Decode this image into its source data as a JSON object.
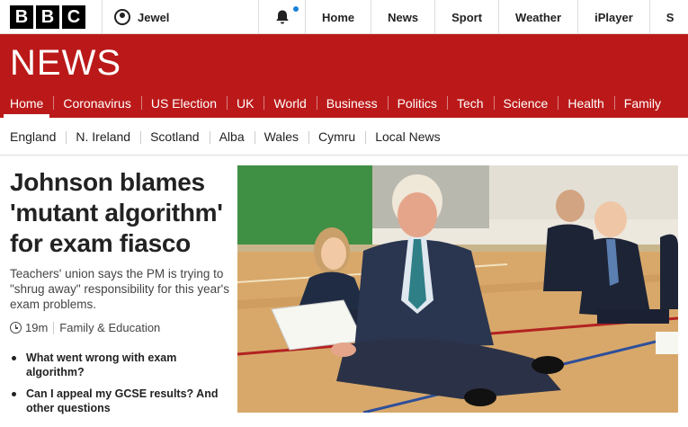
{
  "masthead": {
    "logo_letters": [
      "B",
      "B",
      "C"
    ],
    "account_label": "Jewel",
    "nav": [
      "Home",
      "News",
      "Sport",
      "Weather",
      "iPlayer",
      "S"
    ]
  },
  "banner": {
    "title": "NEWS",
    "color": "#bb1919",
    "nav": [
      "Home",
      "Coronavirus",
      "US Election",
      "UK",
      "World",
      "Business",
      "Politics",
      "Tech",
      "Science",
      "Health",
      "Family"
    ]
  },
  "subnav": [
    "England",
    "N. Ireland",
    "Scotland",
    "Alba",
    "Wales",
    "Cymru",
    "Local News"
  ],
  "story": {
    "headline": "Johnson blames 'mutant algorithm' for exam fiasco",
    "summary": "Teachers' union says the PM is trying to \"shrug away\" responsibility for this year's exam problems.",
    "time": "19m",
    "section": "Family & Education",
    "related": [
      "What went wrong with exam algorithm?",
      "Can I appeal my GCSE results? And other questions"
    ]
  }
}
